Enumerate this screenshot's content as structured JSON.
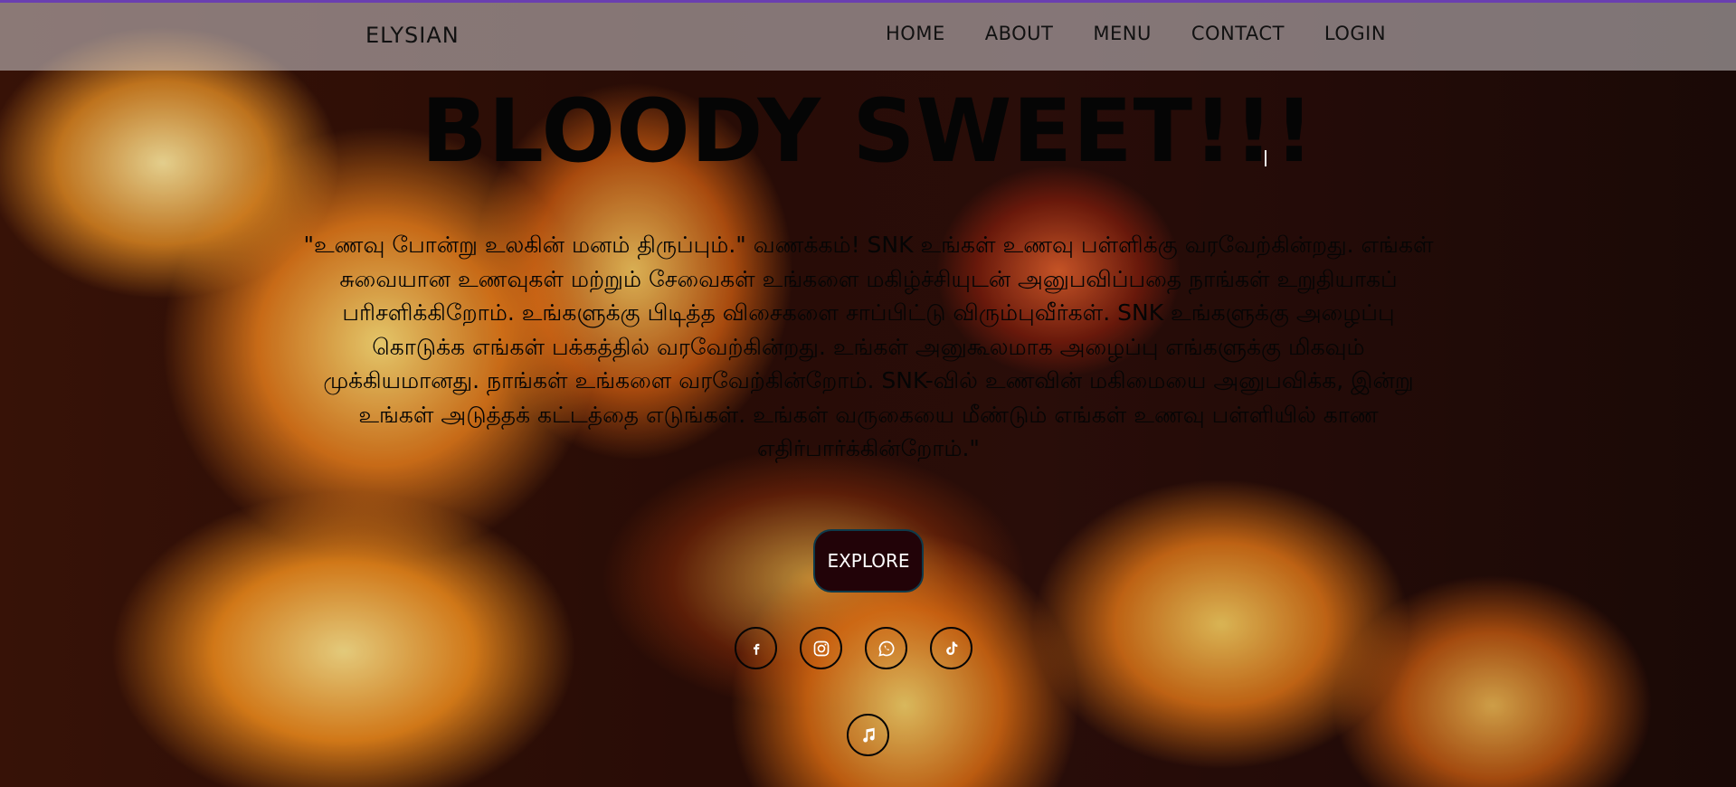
{
  "nav": {
    "brand": "ELYSIAN",
    "items": [
      {
        "label": "HOME"
      },
      {
        "label": "ABOUT"
      },
      {
        "label": "MENU"
      },
      {
        "label": "CONTACT"
      },
      {
        "label": "LOGIN"
      }
    ],
    "top_border_color": "#6a3fb0"
  },
  "hero": {
    "title": "BLOODY SWEET!!!",
    "text": "\"உணவு போன்று உலகின் மனம் திருப்பும்.\" வணக்கம்! SNK உங்கள் உணவு பள்ளிக்கு வரவேற்கின்றது. எங்கள் சுவையான உணவுகள் மற்றும் சேவைகள் உங்களை மகிழ்ச்சியுடன் அனுபவிப்பதை நாங்கள் உறுதியாகப் பரிசளிக்கிறோம். உங்களுக்கு பிடித்த விசைகளை சாப்பிட்டு விரும்புவீர்கள். SNK உங்களுக்கு அழைப்பு கொடுக்க எங்கள் பக்கத்தில் வரவேற்கின்றது. உங்கள் அனுகூலமாக அழைப்பு எங்களுக்கு மிகவும் முக்கியமானது. நாங்கள் உங்களை வரவேற்கின்றோம். SNK-வில் உணவின் மகிமையை அனுபவிக்க, இன்று உங்கள் அடுத்தக் கட்டத்தை எடுங்கள். உங்கள் வருகையை மீண்டும் எங்கள் உணவு பள்ளியில் காண எதிர்பார்க்கின்றோம்.\"",
    "button_label": "EXPLORE"
  },
  "social": {
    "icons": [
      "facebook-icon",
      "instagram-icon",
      "whatsapp-icon",
      "tiktok-icon"
    ],
    "music_icon": "music-note-icon"
  },
  "colors": {
    "button_bg": "#220308",
    "icon_color": "#ffffff"
  }
}
